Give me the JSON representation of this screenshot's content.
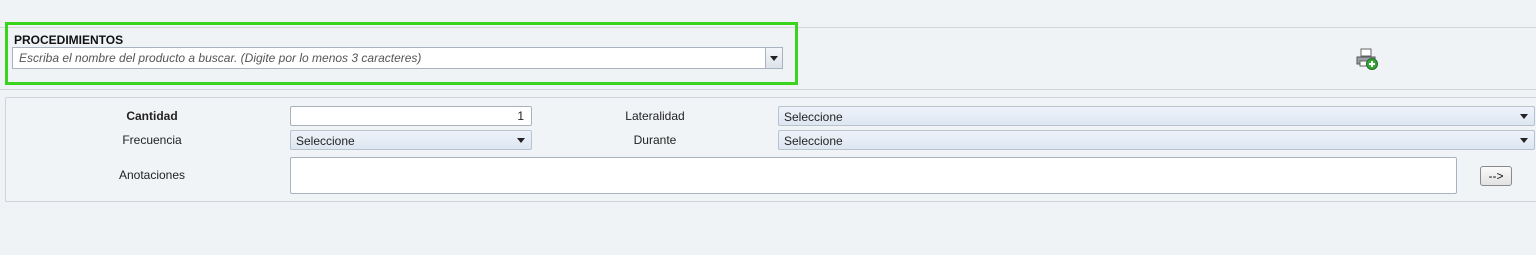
{
  "procedimientos": {
    "title": "PROCEDIMIENTOS",
    "search_placeholder": "Escriba el nombre del producto a buscar. (Digite por lo menos 3 caracteres)",
    "dropdown_icon": "chevron-down-icon",
    "add_icon": "printer-add-icon"
  },
  "form": {
    "cantidad_label": "Cantidad",
    "cantidad_value": "1",
    "lateralidad_label": "Lateralidad",
    "lateralidad_value": "Seleccione",
    "frecuencia_label": "Frecuencia",
    "frecuencia_value": "Seleccione",
    "durante_label": "Durante",
    "durante_value": "Seleccione",
    "anotaciones_label": "Anotaciones",
    "anotaciones_value": "",
    "submit_label": "-->"
  },
  "colors": {
    "highlight": "#39d41e",
    "background": "#f0f3f6",
    "select_fill": "#dde6f1"
  }
}
